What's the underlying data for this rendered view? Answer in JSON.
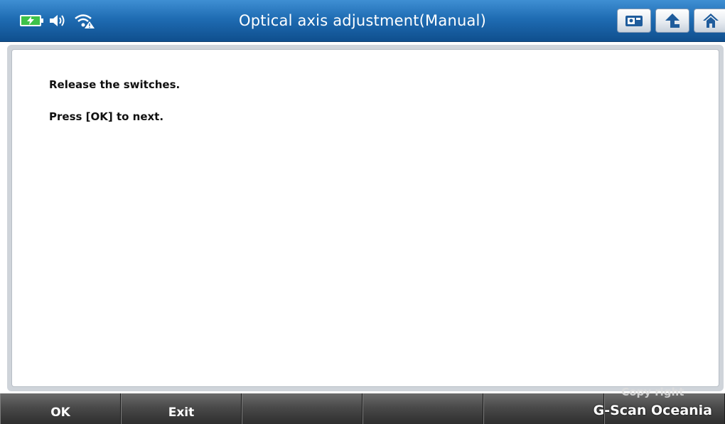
{
  "header": {
    "title": "Optical axis adjustment(Manual)",
    "status_icons": [
      "battery-charging-icon",
      "speaker-icon",
      "wifi-alert-icon"
    ],
    "buttons": [
      "screen-capture-icon",
      "back-arrow-icon",
      "home-icon"
    ]
  },
  "content": {
    "lines": [
      "Release the switches.",
      "Press [OK] to next."
    ]
  },
  "footer": {
    "keys": [
      "OK",
      "Exit",
      "",
      "",
      "",
      ""
    ]
  },
  "watermark": {
    "line1": "Copy right",
    "line2": "G-Scan Oceania"
  },
  "colors": {
    "titlebar": "#1f6cb3",
    "footer": "#4a4a4a",
    "battery": "#3ec24a"
  }
}
